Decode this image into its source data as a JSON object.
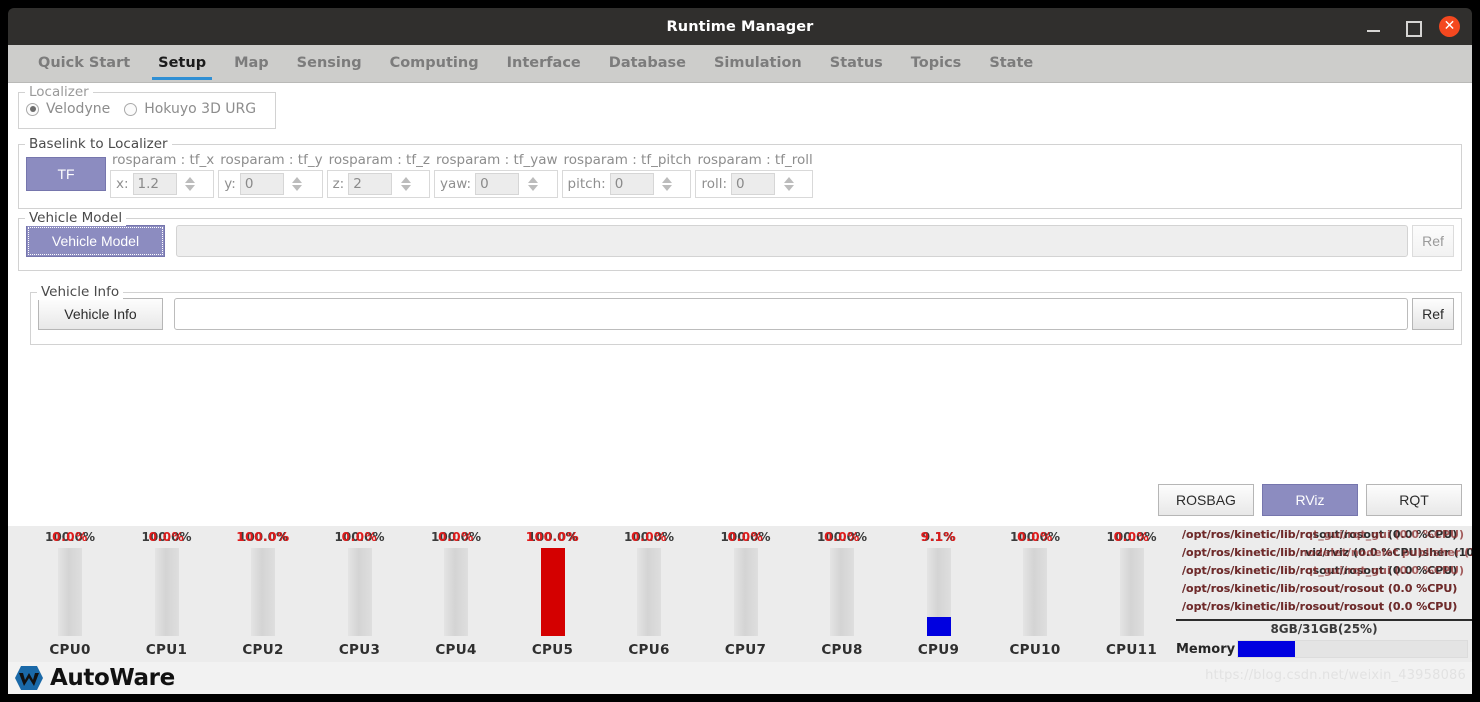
{
  "window": {
    "title": "Runtime Manager",
    "minimize_icon": "minimize-icon",
    "maximize_icon": "maximize-icon",
    "close_icon": "close-icon",
    "close_glyph": "✕"
  },
  "tabs": [
    {
      "label": "Quick Start",
      "active": false
    },
    {
      "label": "Setup",
      "active": true
    },
    {
      "label": "Map",
      "active": false
    },
    {
      "label": "Sensing",
      "active": false
    },
    {
      "label": "Computing",
      "active": false
    },
    {
      "label": "Interface",
      "active": false
    },
    {
      "label": "Database",
      "active": false
    },
    {
      "label": "Simulation",
      "active": false
    },
    {
      "label": "Status",
      "active": false
    },
    {
      "label": "Topics",
      "active": false
    },
    {
      "label": "State",
      "active": false
    }
  ],
  "localizer": {
    "group_title": "Localizer",
    "options": [
      {
        "label": "Velodyne",
        "selected": true
      },
      {
        "label": "Hokuyo 3D URG",
        "selected": false
      }
    ]
  },
  "baselink": {
    "group_title": "Baselink to Localizer",
    "tf_button": "TF",
    "params": [
      {
        "caption": "rosparam : tf_x",
        "key": "x:",
        "value": "1.2"
      },
      {
        "caption": "rosparam : tf_y",
        "key": "y:",
        "value": "0"
      },
      {
        "caption": "rosparam : tf_z",
        "key": "z:",
        "value": "2"
      },
      {
        "caption": "rosparam : tf_yaw",
        "key": "yaw:",
        "value": "0"
      },
      {
        "caption": "rosparam : tf_pitch",
        "key": "pitch:",
        "value": "0"
      },
      {
        "caption": "rosparam : tf_roll",
        "key": "roll:",
        "value": "0"
      }
    ]
  },
  "vehicle_model": {
    "group_title": "Vehicle Model",
    "button": "Vehicle Model",
    "path_value": "",
    "ref_button": "Ref"
  },
  "vehicle_info": {
    "group_title": "Vehicle Info",
    "button": "Vehicle Info",
    "path_value": "",
    "ref_button": "Ref"
  },
  "bottom_buttons": [
    {
      "label": "ROSBAG",
      "style": "normal"
    },
    {
      "label": "RViz",
      "style": "purple"
    },
    {
      "label": "RQT",
      "style": "normal"
    }
  ],
  "monitor": {
    "cpus": [
      {
        "name": "CPU0",
        "percent_front": "0.0%",
        "percent_back": "100.0%",
        "fill_ratio": 0,
        "fill_color": "#d40000"
      },
      {
        "name": "CPU1",
        "percent_front": "0.0%",
        "percent_back": "100.0%",
        "fill_ratio": 0,
        "fill_color": "#d40000"
      },
      {
        "name": "CPU2",
        "percent_front": "100.0%",
        "percent_back": "100.0%",
        "fill_ratio": 0,
        "fill_color": "#d40000"
      },
      {
        "name": "CPU3",
        "percent_front": "0.0%",
        "percent_back": "100.0%",
        "fill_ratio": 0,
        "fill_color": "#d40000"
      },
      {
        "name": "CPU4",
        "percent_front": "0.0%",
        "percent_back": "100.0%",
        "fill_ratio": 0,
        "fill_color": "#d40000"
      },
      {
        "name": "CPU5",
        "percent_front": "100.0%",
        "percent_back": "100.0%",
        "fill_ratio": 1,
        "fill_color": "#d40000"
      },
      {
        "name": "CPU6",
        "percent_front": "0.0%",
        "percent_back": "100.0%",
        "fill_ratio": 0,
        "fill_color": "#d40000"
      },
      {
        "name": "CPU7",
        "percent_front": "0.0%",
        "percent_back": "100.0%",
        "fill_ratio": 0,
        "fill_color": "#d40000"
      },
      {
        "name": "CPU8",
        "percent_front": "0.0%",
        "percent_back": "100.0%",
        "fill_ratio": 0,
        "fill_color": "#d40000"
      },
      {
        "name": "CPU9",
        "percent_front": "9.1%",
        "percent_back": "9.1%",
        "fill_ratio": 0.22,
        "fill_color": "#0000e0"
      },
      {
        "name": "CPU10",
        "percent_front": "0.0%",
        "percent_back": "100.0%",
        "fill_ratio": 0,
        "fill_color": "#d40000"
      },
      {
        "name": "CPU11",
        "percent_front": "0.0%",
        "percent_back": "100.0%",
        "fill_ratio": 0,
        "fill_color": "#d40000"
      }
    ],
    "processes": [
      {
        "text": "/opt/ros/kinetic/lib/rosout/rosout (0.0 %CPU)",
        "ghost": "/opt/ros/kinetic/lib/rqt_gui/rqt_gui (0.0 %CPU)"
      },
      {
        "text": "/opt/ros/kinetic/lib/rviz/rviz (0.0 %CPU)sher (10",
        "ghost": "/opt/ros/kinetic/lib/nodelet/nodelet publisher (10"
      },
      {
        "text": "/opt/ros/kinetic/lib/rosout/rosout (0.0 %CPU)",
        "ghost": "/opt/ros/kinetic/lib/rqt_gui/rqt_gui (0.0 %CPU)"
      },
      {
        "text": "/opt/ros/kinetic/lib/rosout/rosout (0.0 %CPU)",
        "ghost": "/opt/ros/kinetic/lib/rosout/rosout (0.0 %CPU)"
      },
      {
        "text": "/opt/ros/kinetic/lib/rosout/rosout (0.0 %CPU)",
        "ghost": "/opt/ros/kinetic/lib/rosout/rosout (0.0 %CPU)"
      }
    ],
    "memory": {
      "label": "Memory",
      "usage_text": "8GB/31GB(25%)",
      "fill_ratio": 0.25
    }
  },
  "footer": {
    "logo_text": "AutoWare",
    "logo_icon": "autoware-logo-icon",
    "watermark": "https://blog.csdn.net/weixin_43958086"
  },
  "colors": {
    "accent_purple": "#8c8cc0",
    "tab_underline": "#2f8fd4",
    "cpu_red": "#d40000",
    "cpu_blue": "#0000e0",
    "titlebar": "#302f2d",
    "close_red": "#f4481f"
  }
}
